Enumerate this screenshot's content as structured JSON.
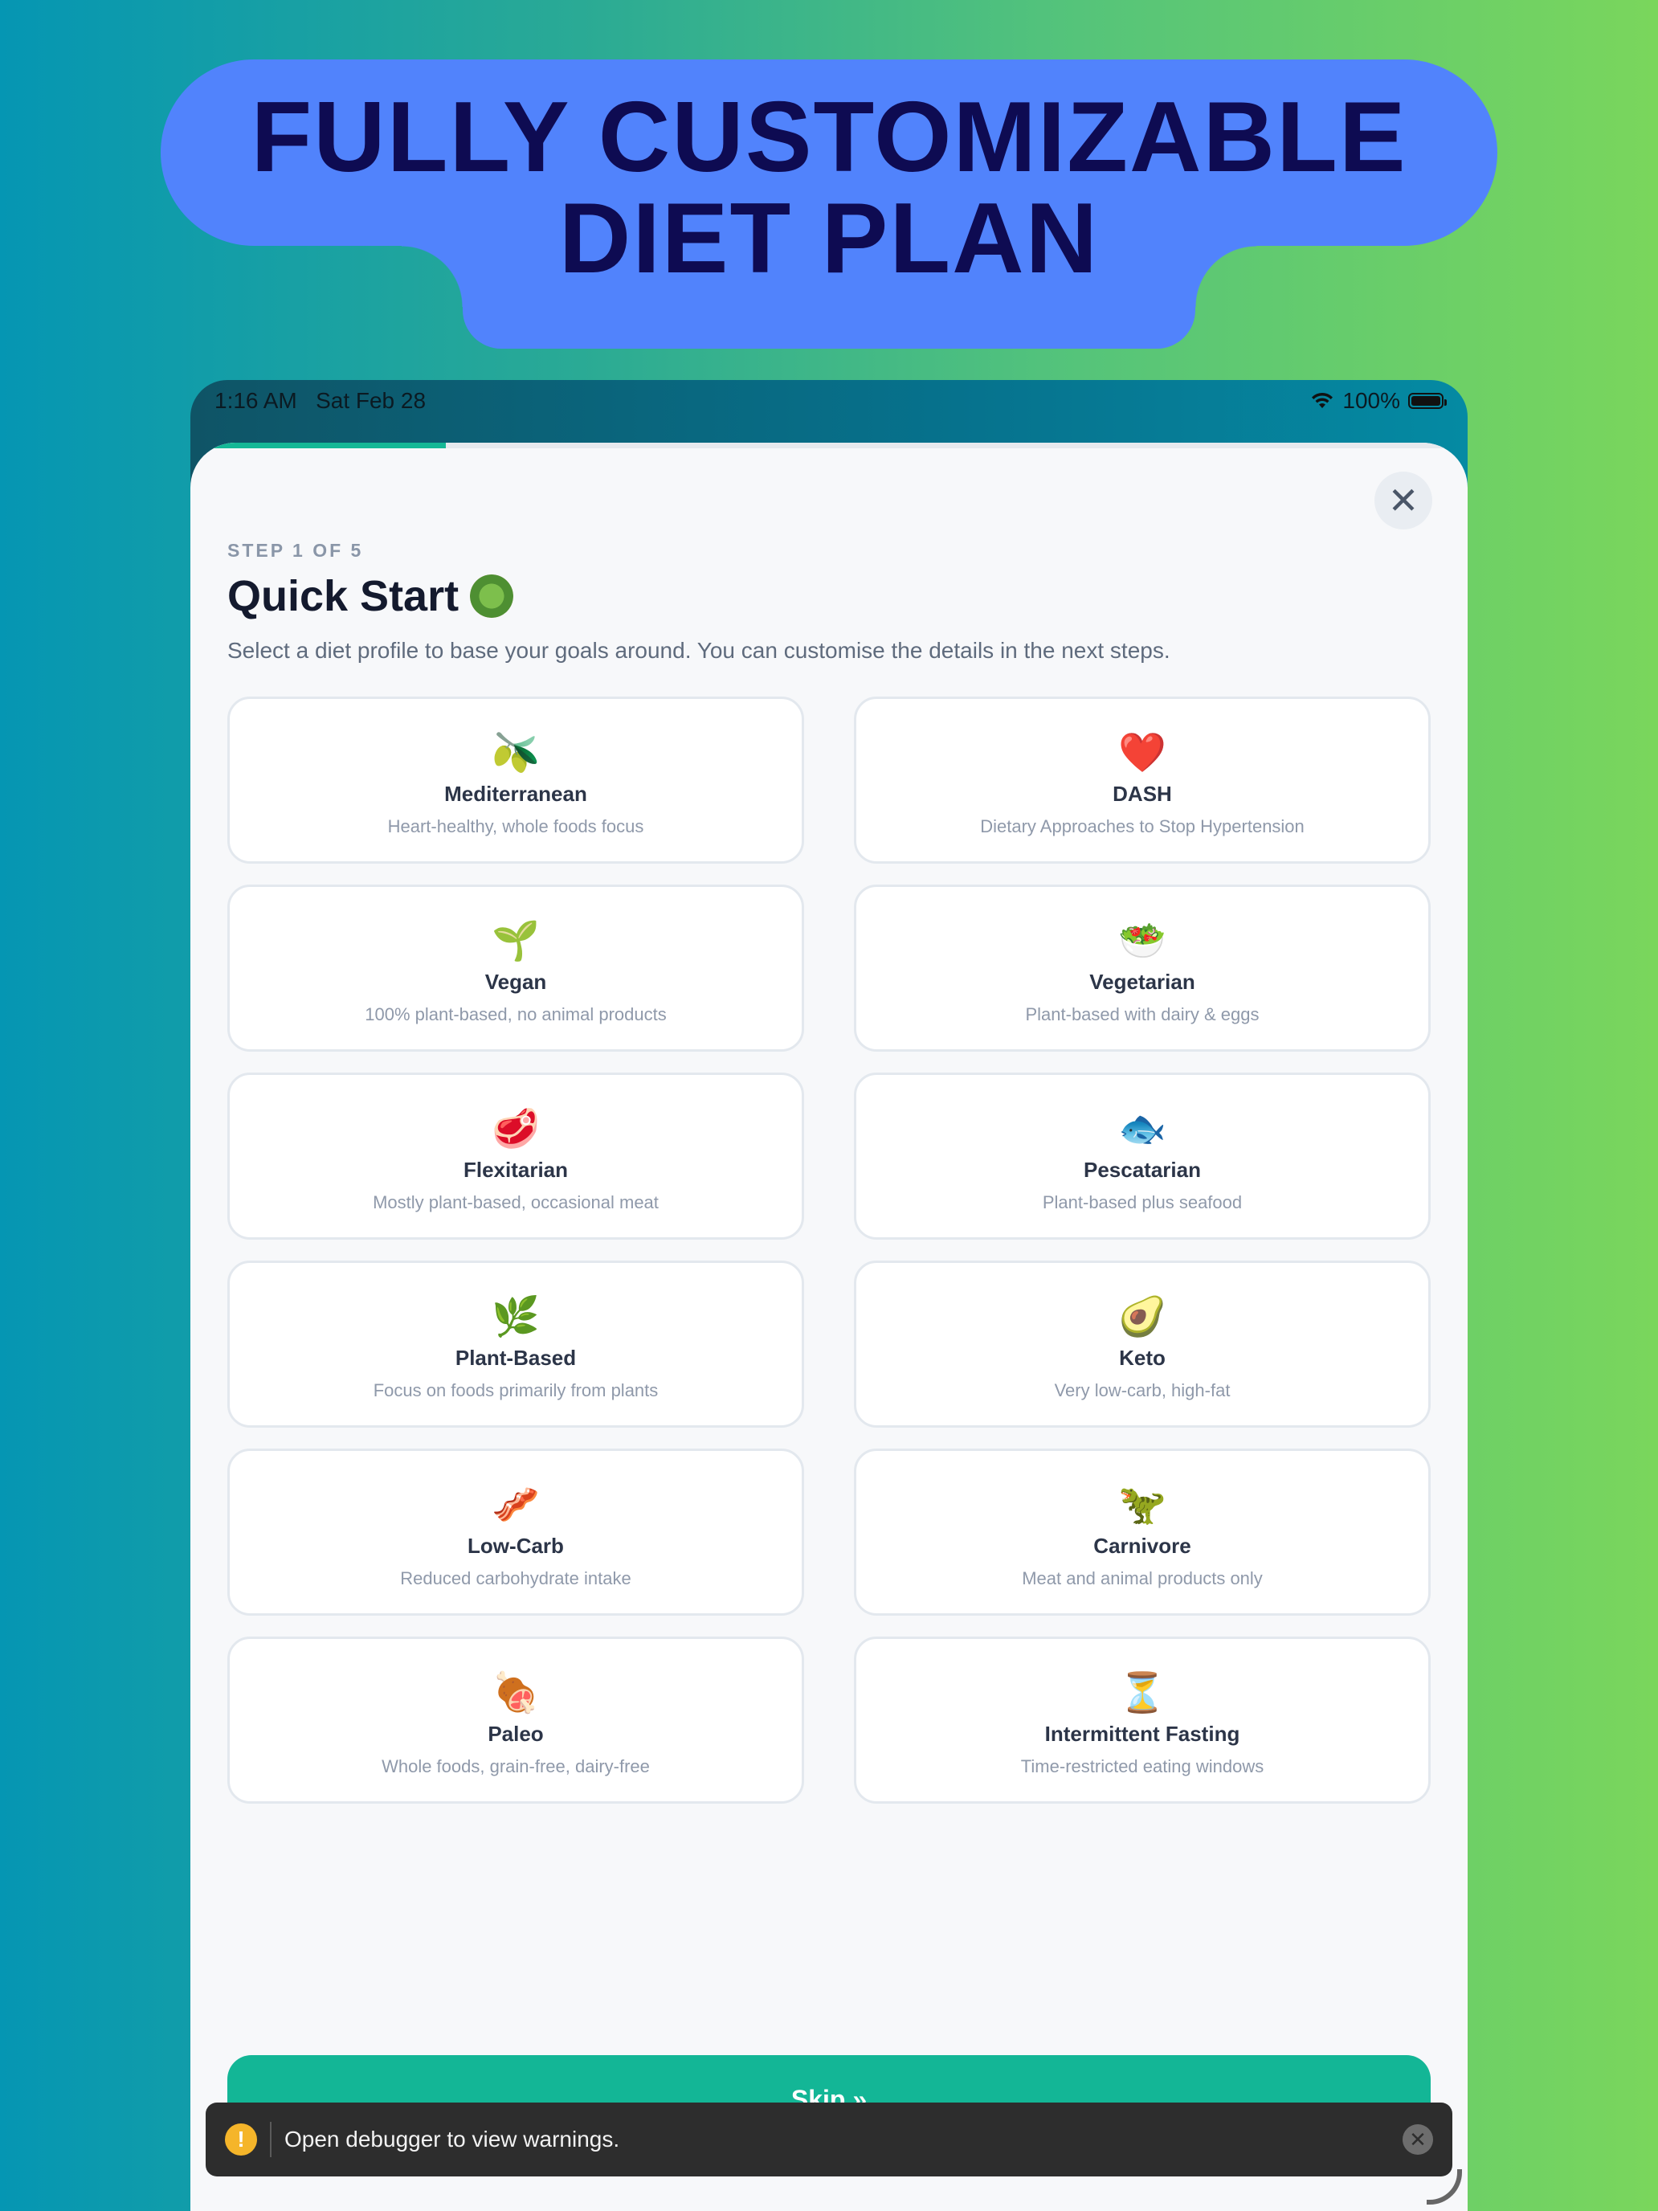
{
  "headline": {
    "line1": "FULLY CUSTOMIZABLE",
    "line2": "DIET PLAN"
  },
  "status_bar": {
    "time": "1:16 AM",
    "date": "Sat Feb 28",
    "battery": "100%"
  },
  "onboarding": {
    "progress": 0.2,
    "step_label": "STEP 1 OF 5",
    "title": "Quick Start",
    "title_icon": "salad-icon",
    "subtitle": "Select a diet profile to base your goals around. You can customise the details in the next steps.",
    "close_icon": "close-icon",
    "skip_label": "Skip »"
  },
  "diets": [
    {
      "icon": "🫒",
      "icon_name": "olive-icon",
      "name": "Mediterranean",
      "desc": "Heart-healthy, whole foods focus"
    },
    {
      "icon": "❤️",
      "icon_name": "heart-icon",
      "name": "DASH",
      "desc": "Dietary Approaches to Stop Hypertension"
    },
    {
      "icon": "🌱",
      "icon_name": "seedling-icon",
      "name": "Vegan",
      "desc": "100% plant-based, no animal products"
    },
    {
      "icon": "🥗",
      "icon_name": "salad-icon",
      "name": "Vegetarian",
      "desc": "Plant-based with dairy & eggs"
    },
    {
      "icon": "🥩",
      "icon_name": "steak-icon",
      "name": "Flexitarian",
      "desc": "Mostly plant-based, occasional meat"
    },
    {
      "icon": "🐟",
      "icon_name": "fish-icon",
      "name": "Pescatarian",
      "desc": "Plant-based plus seafood"
    },
    {
      "icon": "🌿",
      "icon_name": "herb-icon",
      "name": "Plant-Based",
      "desc": "Focus on foods primarily from plants"
    },
    {
      "icon": "🥑",
      "icon_name": "avocado-icon",
      "name": "Keto",
      "desc": "Very low-carb, high-fat"
    },
    {
      "icon": "🥓",
      "icon_name": "bacon-icon",
      "name": "Low-Carb",
      "desc": "Reduced carbohydrate intake"
    },
    {
      "icon": "🦖",
      "icon_name": "dinosaur-icon",
      "name": "Carnivore",
      "desc": "Meat and animal products only"
    },
    {
      "icon": "🍖",
      "icon_name": "meat-on-bone-icon",
      "name": "Paleo",
      "desc": "Whole foods, grain-free, dairy-free"
    },
    {
      "icon": "⏳",
      "icon_name": "hourglass-icon",
      "name": "Intermittent Fasting",
      "desc": "Time-restricted eating windows"
    }
  ],
  "toast": {
    "icon": "!",
    "text": "Open debugger to view warnings."
  },
  "colors": {
    "accent": "#13b696",
    "headline_bg": "#5183fc",
    "headline_text": "#0e0b52"
  }
}
